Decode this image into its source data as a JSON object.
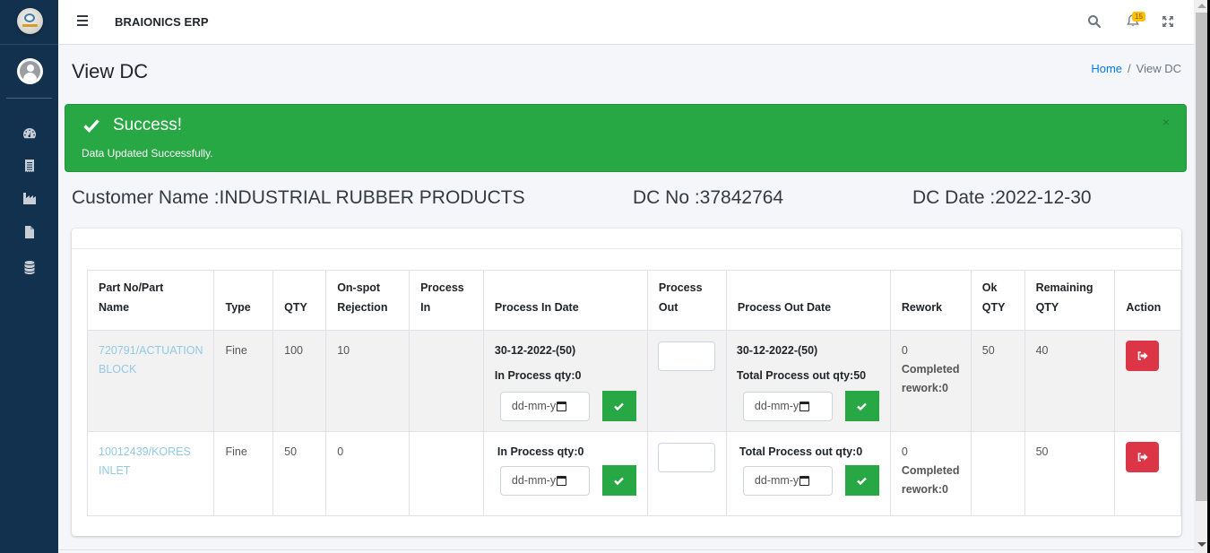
{
  "app": {
    "brand": "BRAIONICS ERP",
    "notification_count": "15"
  },
  "sidebar": {
    "items": [
      {
        "name": "dashboard",
        "icon": "tachometer-icon"
      },
      {
        "name": "receipts",
        "icon": "receipt-icon"
      },
      {
        "name": "industry",
        "icon": "industry-icon"
      },
      {
        "name": "documents",
        "icon": "file-icon"
      },
      {
        "name": "database",
        "icon": "database-icon"
      }
    ]
  },
  "page": {
    "title": "View DC",
    "breadcrumb": {
      "home": "Home",
      "separator": "/",
      "current": "View DC"
    }
  },
  "alert": {
    "title": "Success!",
    "message": "Data Updated Successfully.",
    "close": "×",
    "color": "#28a745"
  },
  "dc_info": {
    "customer": "Customer Name :INDUSTRIAL RUBBER PRODUCTS",
    "dc_no": "DC No :37842764",
    "dc_date": "DC Date :2022-12-30"
  },
  "table": {
    "headers": [
      {
        "line1": "Part No/Part",
        "line2": "Name"
      },
      {
        "line1": "",
        "line2": "Type"
      },
      {
        "line1": "",
        "line2": "QTY"
      },
      {
        "line1": "On-spot",
        "line2": "Rejection"
      },
      {
        "line1": "Process",
        "line2": "In"
      },
      {
        "line1": "",
        "line2": "Process In Date"
      },
      {
        "line1": "Process",
        "line2": "Out"
      },
      {
        "line1": "",
        "line2": "Process Out Date"
      },
      {
        "line1": "",
        "line2": "Rework"
      },
      {
        "line1": "Ok",
        "line2": "QTY"
      },
      {
        "line1": "Remaining",
        "line2": "QTY"
      },
      {
        "line1": "",
        "line2": "Action"
      }
    ],
    "rows": [
      {
        "part_line1": "720791/ACTUATION",
        "part_line2": "BLOCK",
        "type": "Fine",
        "qty": "100",
        "rejection": "10",
        "process_in": "",
        "process_in_date_entry": "30-12-2022-(50)",
        "in_process_qty": "In Process qty:0",
        "process_in_date_placeholder": "dd-mm-y",
        "process_out_value": "",
        "process_out_date_entry": "30-12-2022-(50)",
        "total_process_out": "Total Process out qty:50",
        "process_out_date_placeholder": "dd-mm-y",
        "rework": "0",
        "completed_rework_1": "Completed",
        "completed_rework_2": "rework:0",
        "ok_qty": "50",
        "remaining_qty": "40"
      },
      {
        "part_line1": "10012439/KORES",
        "part_line2": "INLET",
        "type": "Fine",
        "qty": "50",
        "rejection": "0",
        "process_in": "",
        "in_process_qty": "In Process qty:0",
        "process_in_date_placeholder": "dd-mm-y",
        "process_out_value": "",
        "total_process_out": "Total Process out qty:0",
        "process_out_date_placeholder": "dd-mm-y",
        "rework": "0",
        "completed_rework_1": "Completed",
        "completed_rework_2": "rework:0",
        "ok_qty": "",
        "remaining_qty": "50"
      }
    ]
  }
}
